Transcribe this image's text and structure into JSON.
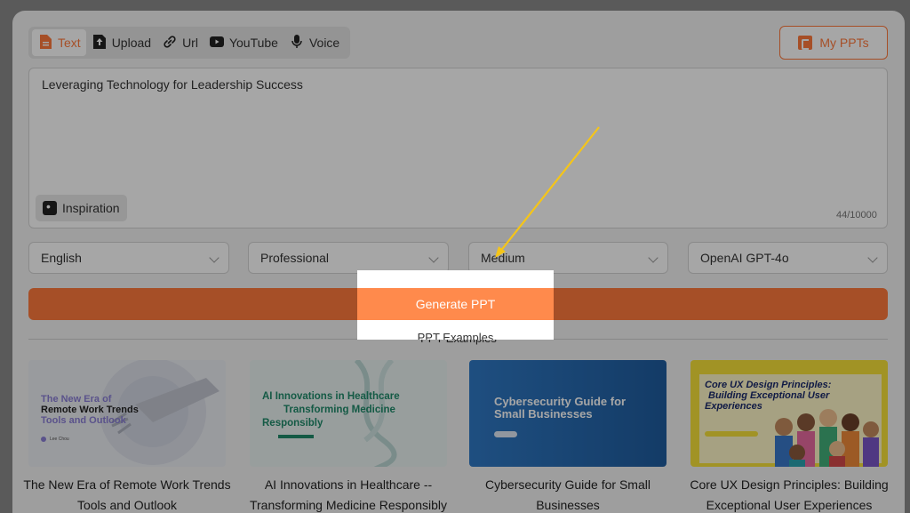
{
  "tabs": [
    {
      "label": "Text",
      "icon": "document-icon",
      "active": true
    },
    {
      "label": "Upload",
      "icon": "upload-icon",
      "active": false
    },
    {
      "label": "Url",
      "icon": "link-icon",
      "active": false
    },
    {
      "label": "YouTube",
      "icon": "youtube-icon",
      "active": false
    },
    {
      "label": "Voice",
      "icon": "microphone-icon",
      "active": false
    }
  ],
  "my_ppts_label": "My PPTs",
  "editor": {
    "value": "Leveraging Technology for Leadership Success",
    "inspiration_label": "Inspiration",
    "counter": "44/10000"
  },
  "selects": {
    "language": "English",
    "tone": "Professional",
    "length": "Medium",
    "model": "OpenAI GPT-4o"
  },
  "generate_label": "Generate PPT",
  "examples_label": "PPT Examples",
  "examples": [
    {
      "thumb_title_1": "The New Era of",
      "thumb_title_2": "Remote Work Trends",
      "thumb_title_3": "Tools and Outlook",
      "author": "Lee Chou",
      "caption_1": "The New Era of Remote Work Trends",
      "caption_2": "Tools and Outlook"
    },
    {
      "thumb_title_1": "AI Innovations in Healthcare",
      "thumb_title_2": "Transforming Medicine",
      "thumb_title_3": "Responsibly",
      "caption_1": "AI Innovations in Healthcare --",
      "caption_2": "Transforming Medicine Responsibly"
    },
    {
      "thumb_title_1": "Cybersecurity Guide for",
      "thumb_title_2": "Small Businesses",
      "caption_1": "Cybersecurity Guide for Small",
      "caption_2": "Businesses"
    },
    {
      "thumb_title_1": "Core UX Design Principles:",
      "thumb_title_2": "Building Exceptional User",
      "thumb_title_3": "Experiences",
      "caption_1": "Core UX Design Principles: Building",
      "caption_2": "Exceptional User Experiences"
    }
  ],
  "colors": {
    "accent": "#ff7a3d",
    "annotation_arrow": "#f5c518"
  }
}
